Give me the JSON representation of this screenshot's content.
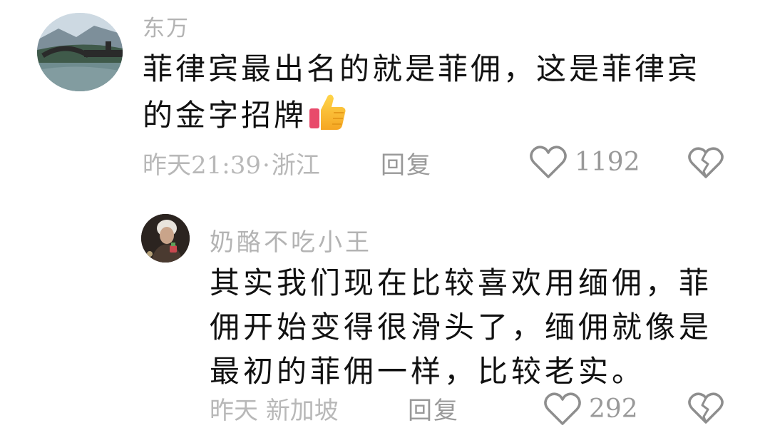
{
  "comment": {
    "username": "东万",
    "body": "菲律宾最出名的就是菲佣，这是菲律宾的金字招牌",
    "body_emoji": "thumbs-up-icon",
    "time": "昨天21:39",
    "separator": "·",
    "location": "浙江",
    "reply_label": "回复",
    "like_count": "1192",
    "like_icon": "heart-outline-icon",
    "dislike_icon": "broken-heart-icon"
  },
  "reply": {
    "username": "奶酪不吃小王",
    "body": "其实我们现在比较喜欢用缅佣，菲佣开始变得很滑头了，缅佣就像是最初的菲佣一样，比较老实。",
    "time": "昨天",
    "location": "新加坡",
    "reply_label": "回复",
    "like_count": "292",
    "like_icon": "heart-outline-icon",
    "dislike_icon": "broken-heart-icon"
  },
  "colors": {
    "username": "#b3b3b3",
    "body_text": "#111111",
    "meta_text": "#b8b8b8",
    "icon_stroke": "#8e8e8e"
  }
}
